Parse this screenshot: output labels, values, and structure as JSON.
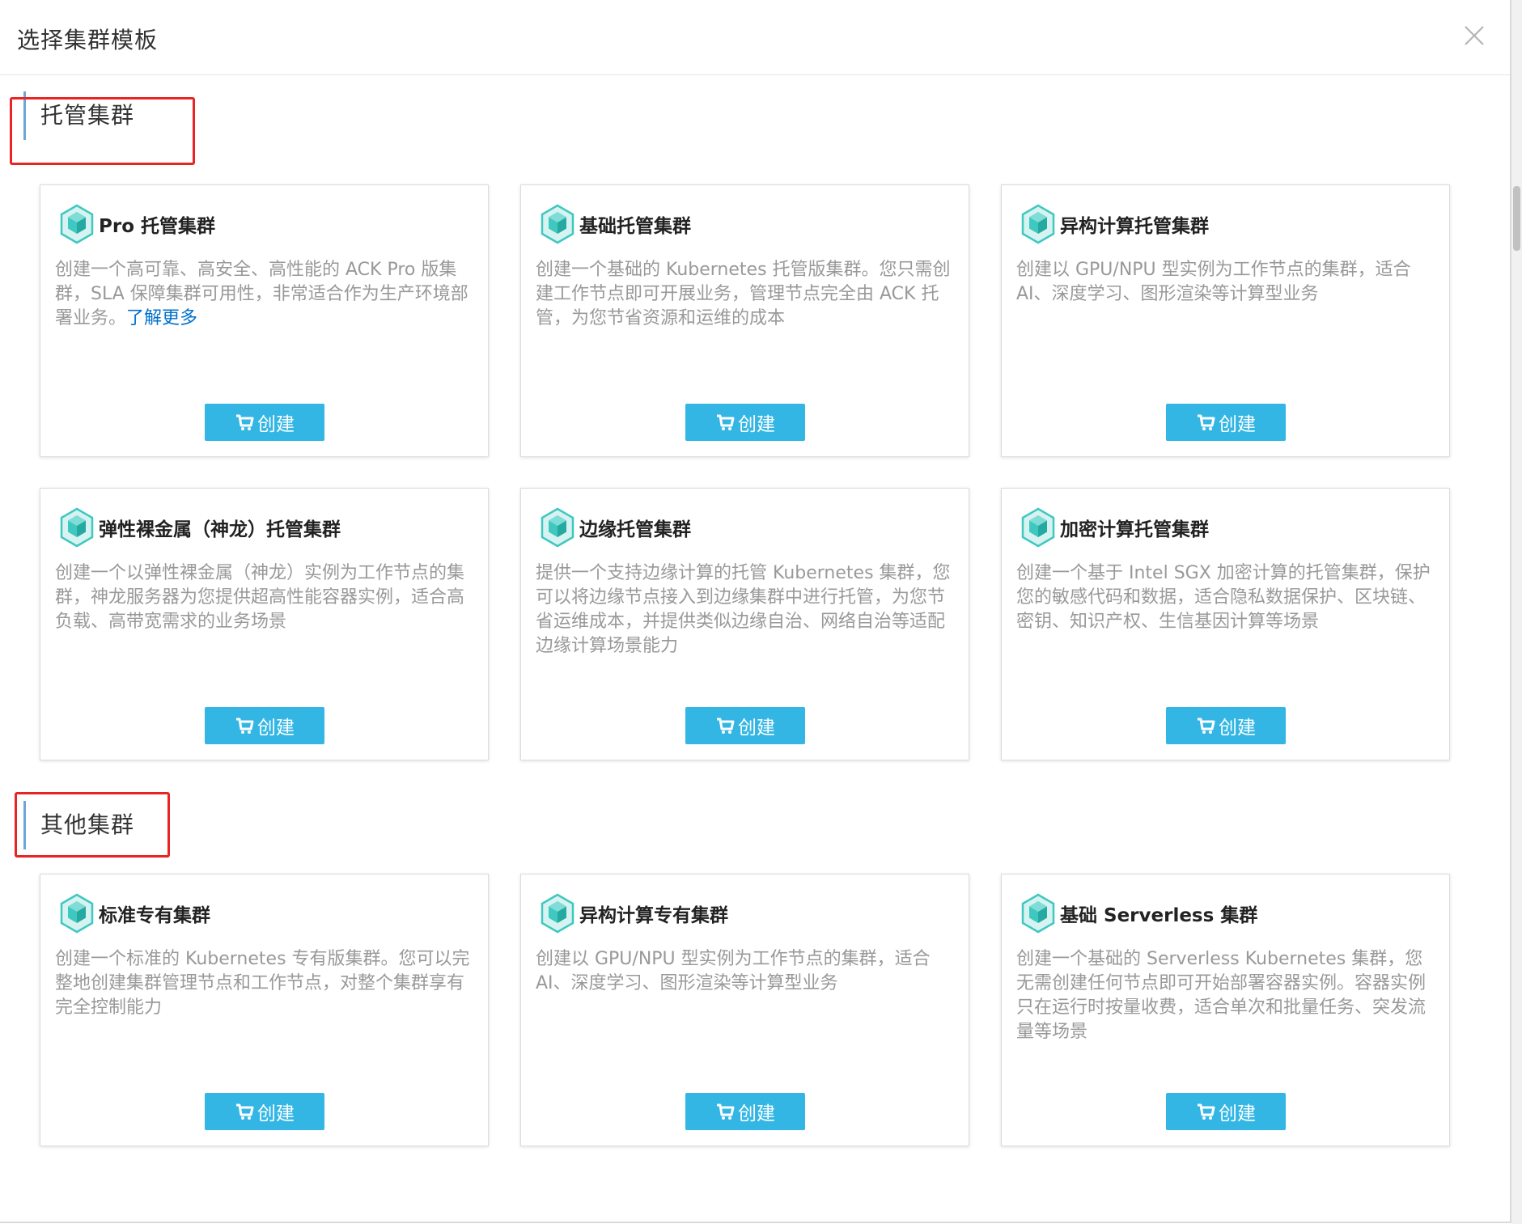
{
  "modal": {
    "title": "选择集群模板",
    "close_icon": "close-icon"
  },
  "sections": [
    {
      "heading": "托管集群",
      "cards": [
        {
          "icon": "cluster-hexagon-icon",
          "title": "Pro 托管集群",
          "description": "创建一个高可靠、高安全、高性能的 ACK Pro 版集群，SLA 保障集群可用性，非常适合作为生产环境部署业务。",
          "link": "了解更多",
          "button": "创建"
        },
        {
          "icon": "cluster-hexagon-icon",
          "title": "基础托管集群",
          "description": "创建一个基础的 Kubernetes 托管版集群。您只需创建工作节点即可开展业务，管理节点完全由 ACK 托管，为您节省资源和运维的成本",
          "button": "创建"
        },
        {
          "icon": "cluster-hexagon-icon",
          "title": "异构计算托管集群",
          "description": "创建以 GPU/NPU 型实例为工作节点的集群，适合 AI、深度学习、图形渲染等计算型业务",
          "button": "创建"
        },
        {
          "icon": "cluster-hexagon-icon",
          "title": "弹性裸金属（神龙）托管集群",
          "description": "创建一个以弹性裸金属（神龙）实例为工作节点的集群，神龙服务器为您提供超高性能容器实例，适合高负载、高带宽需求的业务场景",
          "button": "创建"
        },
        {
          "icon": "cluster-hexagon-icon",
          "title": "边缘托管集群",
          "description": "提供一个支持边缘计算的托管 Kubernetes 集群，您可以将边缘节点接入到边缘集群中进行托管，为您节省运维成本，并提供类似边缘自治、网络自治等适配边缘计算场景能力",
          "button": "创建"
        },
        {
          "icon": "cluster-hexagon-icon",
          "title": "加密计算托管集群",
          "description": "创建一个基于 Intel SGX 加密计算的托管集群，保护您的敏感代码和数据，适合隐私数据保护、区块链、密钥、知识产权、生信基因计算等场景",
          "button": "创建"
        }
      ]
    },
    {
      "heading": "其他集群",
      "cards": [
        {
          "icon": "cluster-hexagon-icon",
          "title": "标准专有集群",
          "description": "创建一个标准的 Kubernetes 专有版集群。您可以完整地创建集群管理节点和工作节点，对整个集群享有完全控制能力",
          "button": "创建"
        },
        {
          "icon": "cluster-hexagon-icon",
          "title": "异构计算专有集群",
          "description": "创建以 GPU/NPU 型实例为工作节点的集群，适合 AI、深度学习、图形渲染等计算型业务",
          "button": "创建"
        },
        {
          "icon": "cluster-hexagon-icon",
          "title": "基础 Serverless 集群",
          "description": "创建一个基础的 Serverless Kubernetes 集群，您无需创建任何节点即可开始部署容器实例。容器实例只在运行时按量收费，适合单次和批量任务、突发流量等场景",
          "button": "创建"
        }
      ]
    }
  ],
  "colors": {
    "button": "#34b6e4",
    "link": "#0070cc",
    "highlight": "#e82424",
    "icon": "#3ec8c0"
  }
}
